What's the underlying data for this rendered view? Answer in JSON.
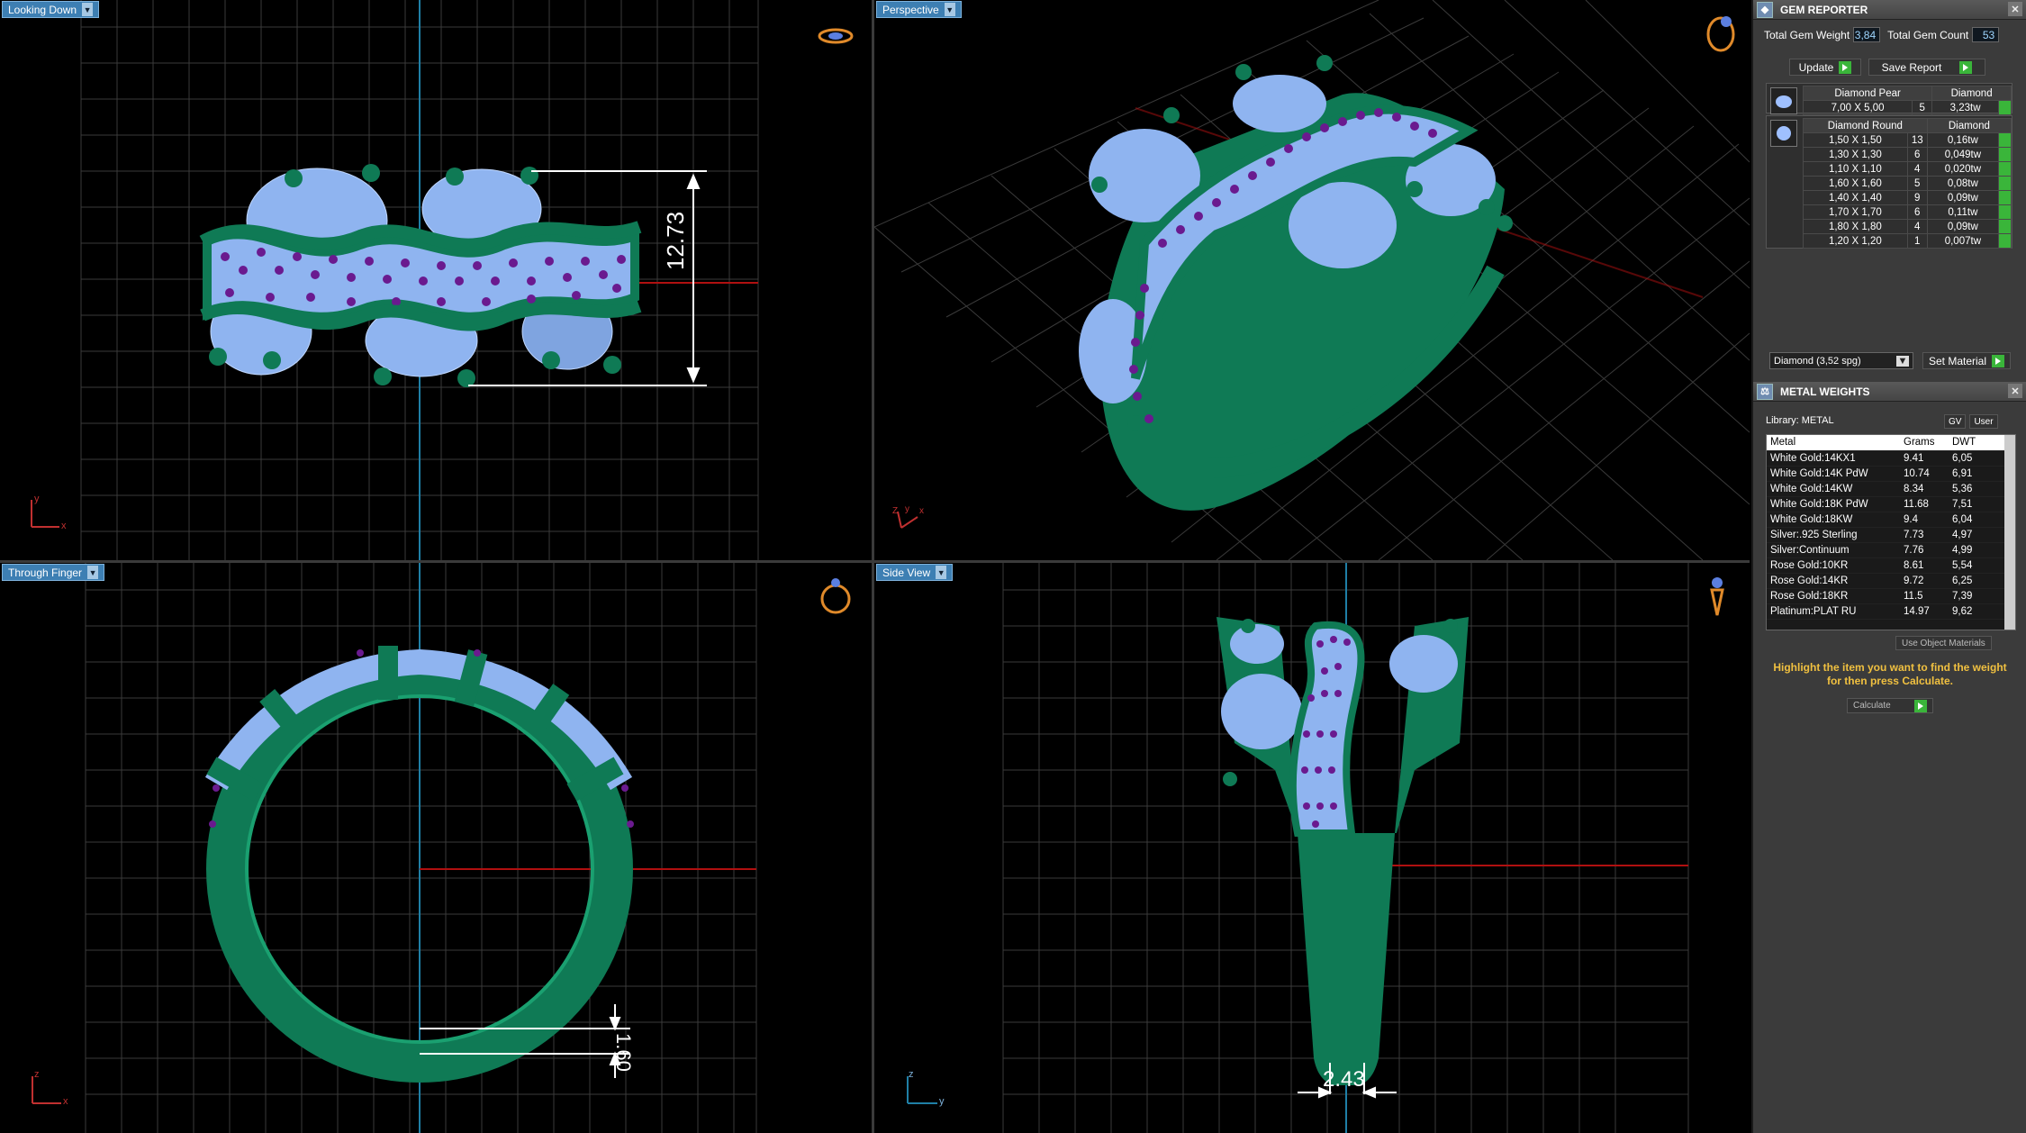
{
  "viewports": {
    "top": {
      "label": "Looking Down",
      "dimension": "12.73",
      "axes": {
        "vertical": "y",
        "horizontal": "x"
      }
    },
    "perspective": {
      "label": "Perspective",
      "axes": {
        "a": "Z",
        "b": "y",
        "c": "x"
      }
    },
    "through": {
      "label": "Through Finger",
      "dimension": "1.60",
      "axes": {
        "vertical": "z",
        "horizontal": "x"
      }
    },
    "side": {
      "label": "Side View",
      "dimension": "2.43",
      "axes": {
        "vertical": "z",
        "horizontal": "y"
      }
    }
  },
  "gem_reporter": {
    "title": "GEM REPORTER",
    "total_weight_label": "Total Gem Weight",
    "total_weight": "3,84",
    "total_count_label": "Total Gem Count",
    "total_count": "53",
    "update_label": "Update",
    "save_label": "Save Report",
    "groups": [
      {
        "name": "Diamond Pear",
        "material": "Diamond",
        "rows": [
          {
            "size": "7,00 X 5,00",
            "count": "5",
            "weight": "3,23tw"
          }
        ]
      },
      {
        "name": "Diamond Round",
        "material": "Diamond",
        "rows": [
          {
            "size": "1,50 X 1,50",
            "count": "13",
            "weight": "0,16tw"
          },
          {
            "size": "1,30 X 1,30",
            "count": "6",
            "weight": "0,049tw"
          },
          {
            "size": "1,10 X 1,10",
            "count": "4",
            "weight": "0,020tw"
          },
          {
            "size": "1,60 X 1,60",
            "count": "5",
            "weight": "0,08tw"
          },
          {
            "size": "1,40 X 1,40",
            "count": "9",
            "weight": "0,09tw"
          },
          {
            "size": "1,70 X 1,70",
            "count": "6",
            "weight": "0,11tw"
          },
          {
            "size": "1,80 X 1,80",
            "count": "4",
            "weight": "0,09tw"
          },
          {
            "size": "1,20 X 1,20",
            "count": "1",
            "weight": "0,007tw"
          }
        ]
      }
    ],
    "material_select": "Diamond    (3,52 spg)",
    "set_material_label": "Set Material"
  },
  "metal_weights": {
    "title": "METAL WEIGHTS",
    "library_label": "Library: METAL",
    "gv_label": "GV",
    "user_label": "User",
    "columns": [
      "Metal",
      "Grams",
      "DWT"
    ],
    "rows": [
      [
        "White Gold:14KX1",
        "9.41",
        "6,05"
      ],
      [
        "White Gold:14K PdW",
        "10.74",
        "6,91"
      ],
      [
        "White Gold:14KW",
        "8.34",
        "5,36"
      ],
      [
        "White Gold:18K PdW",
        "11.68",
        "7,51"
      ],
      [
        "White Gold:18KW",
        "9.4",
        "6,04"
      ],
      [
        "Silver:.925 Sterling",
        "7.73",
        "4,97"
      ],
      [
        "Silver:Continuum",
        "7.76",
        "4,99"
      ],
      [
        "Rose Gold:10KR",
        "8.61",
        "5,54"
      ],
      [
        "Rose Gold:14KR",
        "9.72",
        "6,25"
      ],
      [
        "Rose Gold:18KR",
        "11.5",
        "7,39"
      ],
      [
        "Platinum:PLAT RU",
        "14.97",
        "9,62"
      ]
    ],
    "use_object_materials": "Use Object Materials",
    "hint": "Highlight the item you want to find the weight for then press Calculate.",
    "calculate_label": "Calculate"
  },
  "colors": {
    "metal": "#0f7a55",
    "gem": "#8fb4f0",
    "accent_gem": "#6a1a8f",
    "hint": "#f0c040",
    "label_bg": "#3d7fb3"
  }
}
